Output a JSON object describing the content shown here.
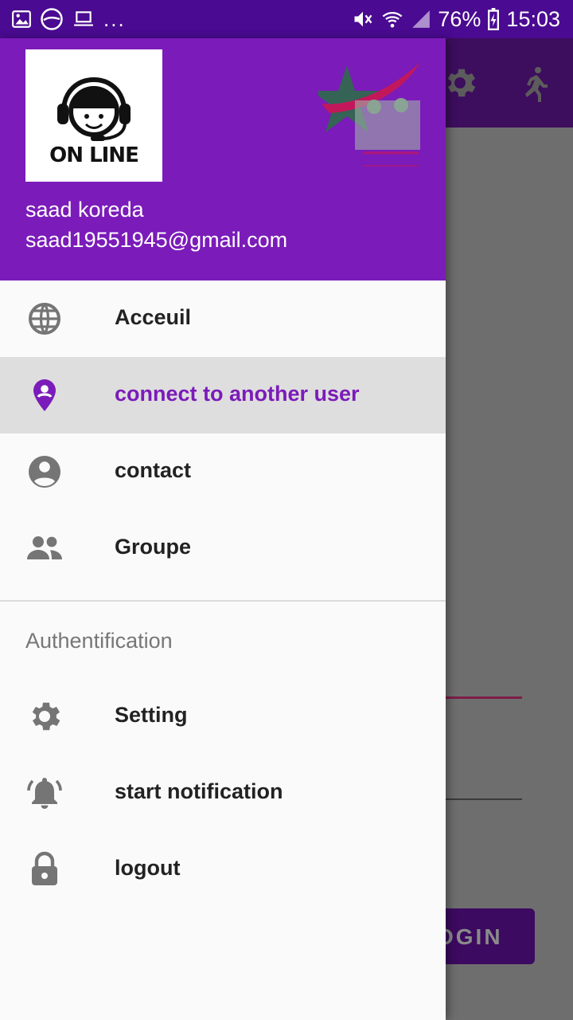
{
  "status_bar": {
    "left_icons": [
      "image-icon",
      "app-icon",
      "laptop-icon"
    ],
    "overflow": "...",
    "battery": "76%",
    "time": "15:03",
    "right_icons": [
      "mute-icon",
      "wifi-icon",
      "signal-icon",
      "battery-charging-icon"
    ]
  },
  "header": {
    "logo_text": "ON LINE",
    "user_name": "saad koreda",
    "user_email": "saad19551945@gmail.com"
  },
  "menu": {
    "items": [
      {
        "label": "Acceuil",
        "icon": "globe-icon",
        "active": false
      },
      {
        "label": "connect to another user",
        "icon": "location-pin-icon",
        "active": true
      },
      {
        "label": "contact",
        "icon": "account-circle-icon",
        "active": false
      },
      {
        "label": "Groupe",
        "icon": "group-icon",
        "active": false
      }
    ],
    "section_title": "Authentification",
    "auth_items": [
      {
        "label": "Setting",
        "icon": "gear-icon"
      },
      {
        "label": "start notification",
        "icon": "bell-ringing-icon"
      },
      {
        "label": "logout",
        "icon": "lock-icon"
      }
    ]
  },
  "background": {
    "login_label": "OGIN"
  },
  "colors": {
    "primary": "#7b1bb9",
    "status_bar": "#4a0a91",
    "active_row": "#dedede",
    "icon_gray": "#757575"
  }
}
